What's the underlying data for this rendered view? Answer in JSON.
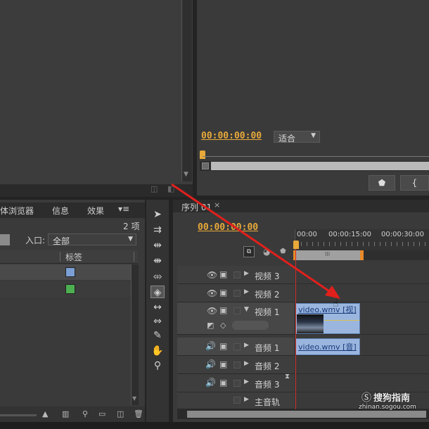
{
  "source_monitor": {},
  "program_monitor": {
    "timecode": "00:00:00:00",
    "fit_select": "适合",
    "marker_button_icon": "marker-icon",
    "in_point_icon": "brace-icon"
  },
  "media_browser": {
    "tabs": [
      "体浏览器",
      "信息",
      "效果"
    ],
    "menu_icon": "panel-menu-icon",
    "item_count": "2 项",
    "entry_label": "入口:",
    "entry_value": "全部",
    "column_label": "标签",
    "label_colors": [
      "#7b9fd4",
      "#4caf50"
    ]
  },
  "tools": [
    "selection-tool",
    "track-select-tool",
    "ripple-edit-tool",
    "rolling-edit-tool",
    "rate-stretch-tool",
    "razor-tool",
    "slip-tool",
    "slide-tool",
    "pen-tool",
    "hand-tool",
    "zoom-tool"
  ],
  "sequence": {
    "tab_label": "序列 01",
    "timecode": "00:00:00:00",
    "ruler": [
      "00:00",
      "00:00:15:00",
      "00:00:30:00"
    ],
    "tracks": [
      {
        "name": "视频 3",
        "type": "video"
      },
      {
        "name": "视频 2",
        "type": "video"
      },
      {
        "name": "视频 1",
        "type": "video"
      },
      {
        "name": "音频 1",
        "type": "audio"
      },
      {
        "name": "音频 2",
        "type": "audio"
      },
      {
        "name": "音频 3",
        "type": "audio"
      },
      {
        "name": "主音轨",
        "type": "master"
      }
    ],
    "video_clip": "video.wmv [视]",
    "audio_clip": "video.wmv [音]"
  },
  "watermark": {
    "brand": "搜狗指南",
    "url": "zhinan.sogou.com"
  },
  "colors": {
    "timecode": "#e8a93a",
    "playhead": "#d0302a",
    "clip": "#7fa6d8",
    "arrow": "#e0201c"
  }
}
